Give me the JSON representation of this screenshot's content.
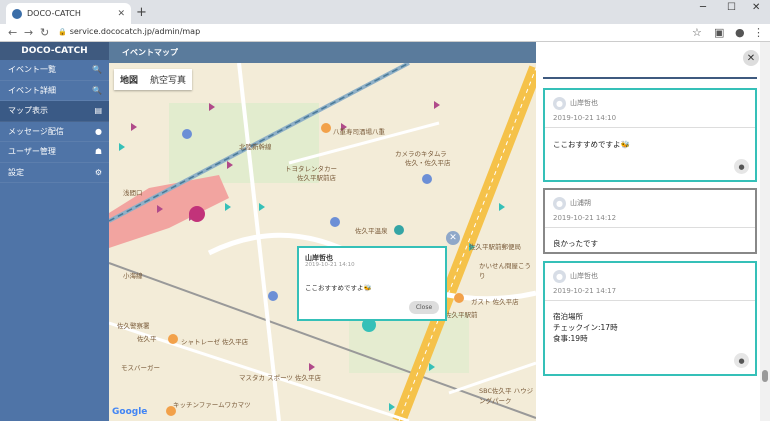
{
  "browser": {
    "tab_title": "DOCO-CATCH",
    "url": "service.dococatch.jp/admin/map"
  },
  "sidebar": {
    "brand": "DOCO-CATCH",
    "items": [
      {
        "label": "イベント一覧",
        "icon": "search-icon"
      },
      {
        "label": "イベント詳細",
        "icon": "search-icon"
      },
      {
        "label": "マップ表示",
        "icon": "map-icon"
      },
      {
        "label": "メッセージ配信",
        "icon": "chat-icon"
      },
      {
        "label": "ユーザー管理",
        "icon": "users-icon"
      },
      {
        "label": "設定",
        "icon": "gear-icon"
      }
    ]
  },
  "topbar": {
    "title": "イベントマップ"
  },
  "map": {
    "toggle": {
      "map_label": "地図",
      "satellite_label": "航空写真"
    },
    "labels": [
      "八重寿司酒場八重",
      "トヨタレンタカー",
      "佐久平駅前店",
      "カメラのキタムラ",
      "佐久・佐久平店",
      "佐久平温泉",
      "佐久警察署",
      "小海線",
      "佐久平",
      "シャトレーゼ 佐久平店",
      "佐久平駅前",
      "ガスト 佐久平店",
      "かいせん問屋こうり",
      "マスタカ スポーツ 佐久平店",
      "キッチンファームワカマツ",
      "モスバーガー",
      "SBC佐久平 ハウジングパーク",
      "佐久平駅前郵便局",
      "北陸新幹線",
      "浅間口"
    ],
    "google": "Google",
    "infowindow": {
      "name": "山岸哲也",
      "date": "2019-10-21 14:10",
      "message": "ここおすすめですよ🐝",
      "close_label": "Close"
    }
  },
  "panel": {
    "cards": [
      {
        "user": "山岸哲也",
        "date": "2019-10-21 14:10",
        "message_lines": [
          "ここおすすめですよ🐝"
        ],
        "style": "teal",
        "pin": true
      },
      {
        "user": "山浦朔",
        "date": "2019-10-21 14:12",
        "message_lines": [
          "良かったです"
        ],
        "style": "gray",
        "pin": false
      },
      {
        "user": "山岸哲也",
        "date": "2019-10-21 14:17",
        "message_lines": [
          "宿泊場所",
          "チェックイン:17時",
          "食事:19時"
        ],
        "style": "teal",
        "pin": true
      }
    ]
  }
}
